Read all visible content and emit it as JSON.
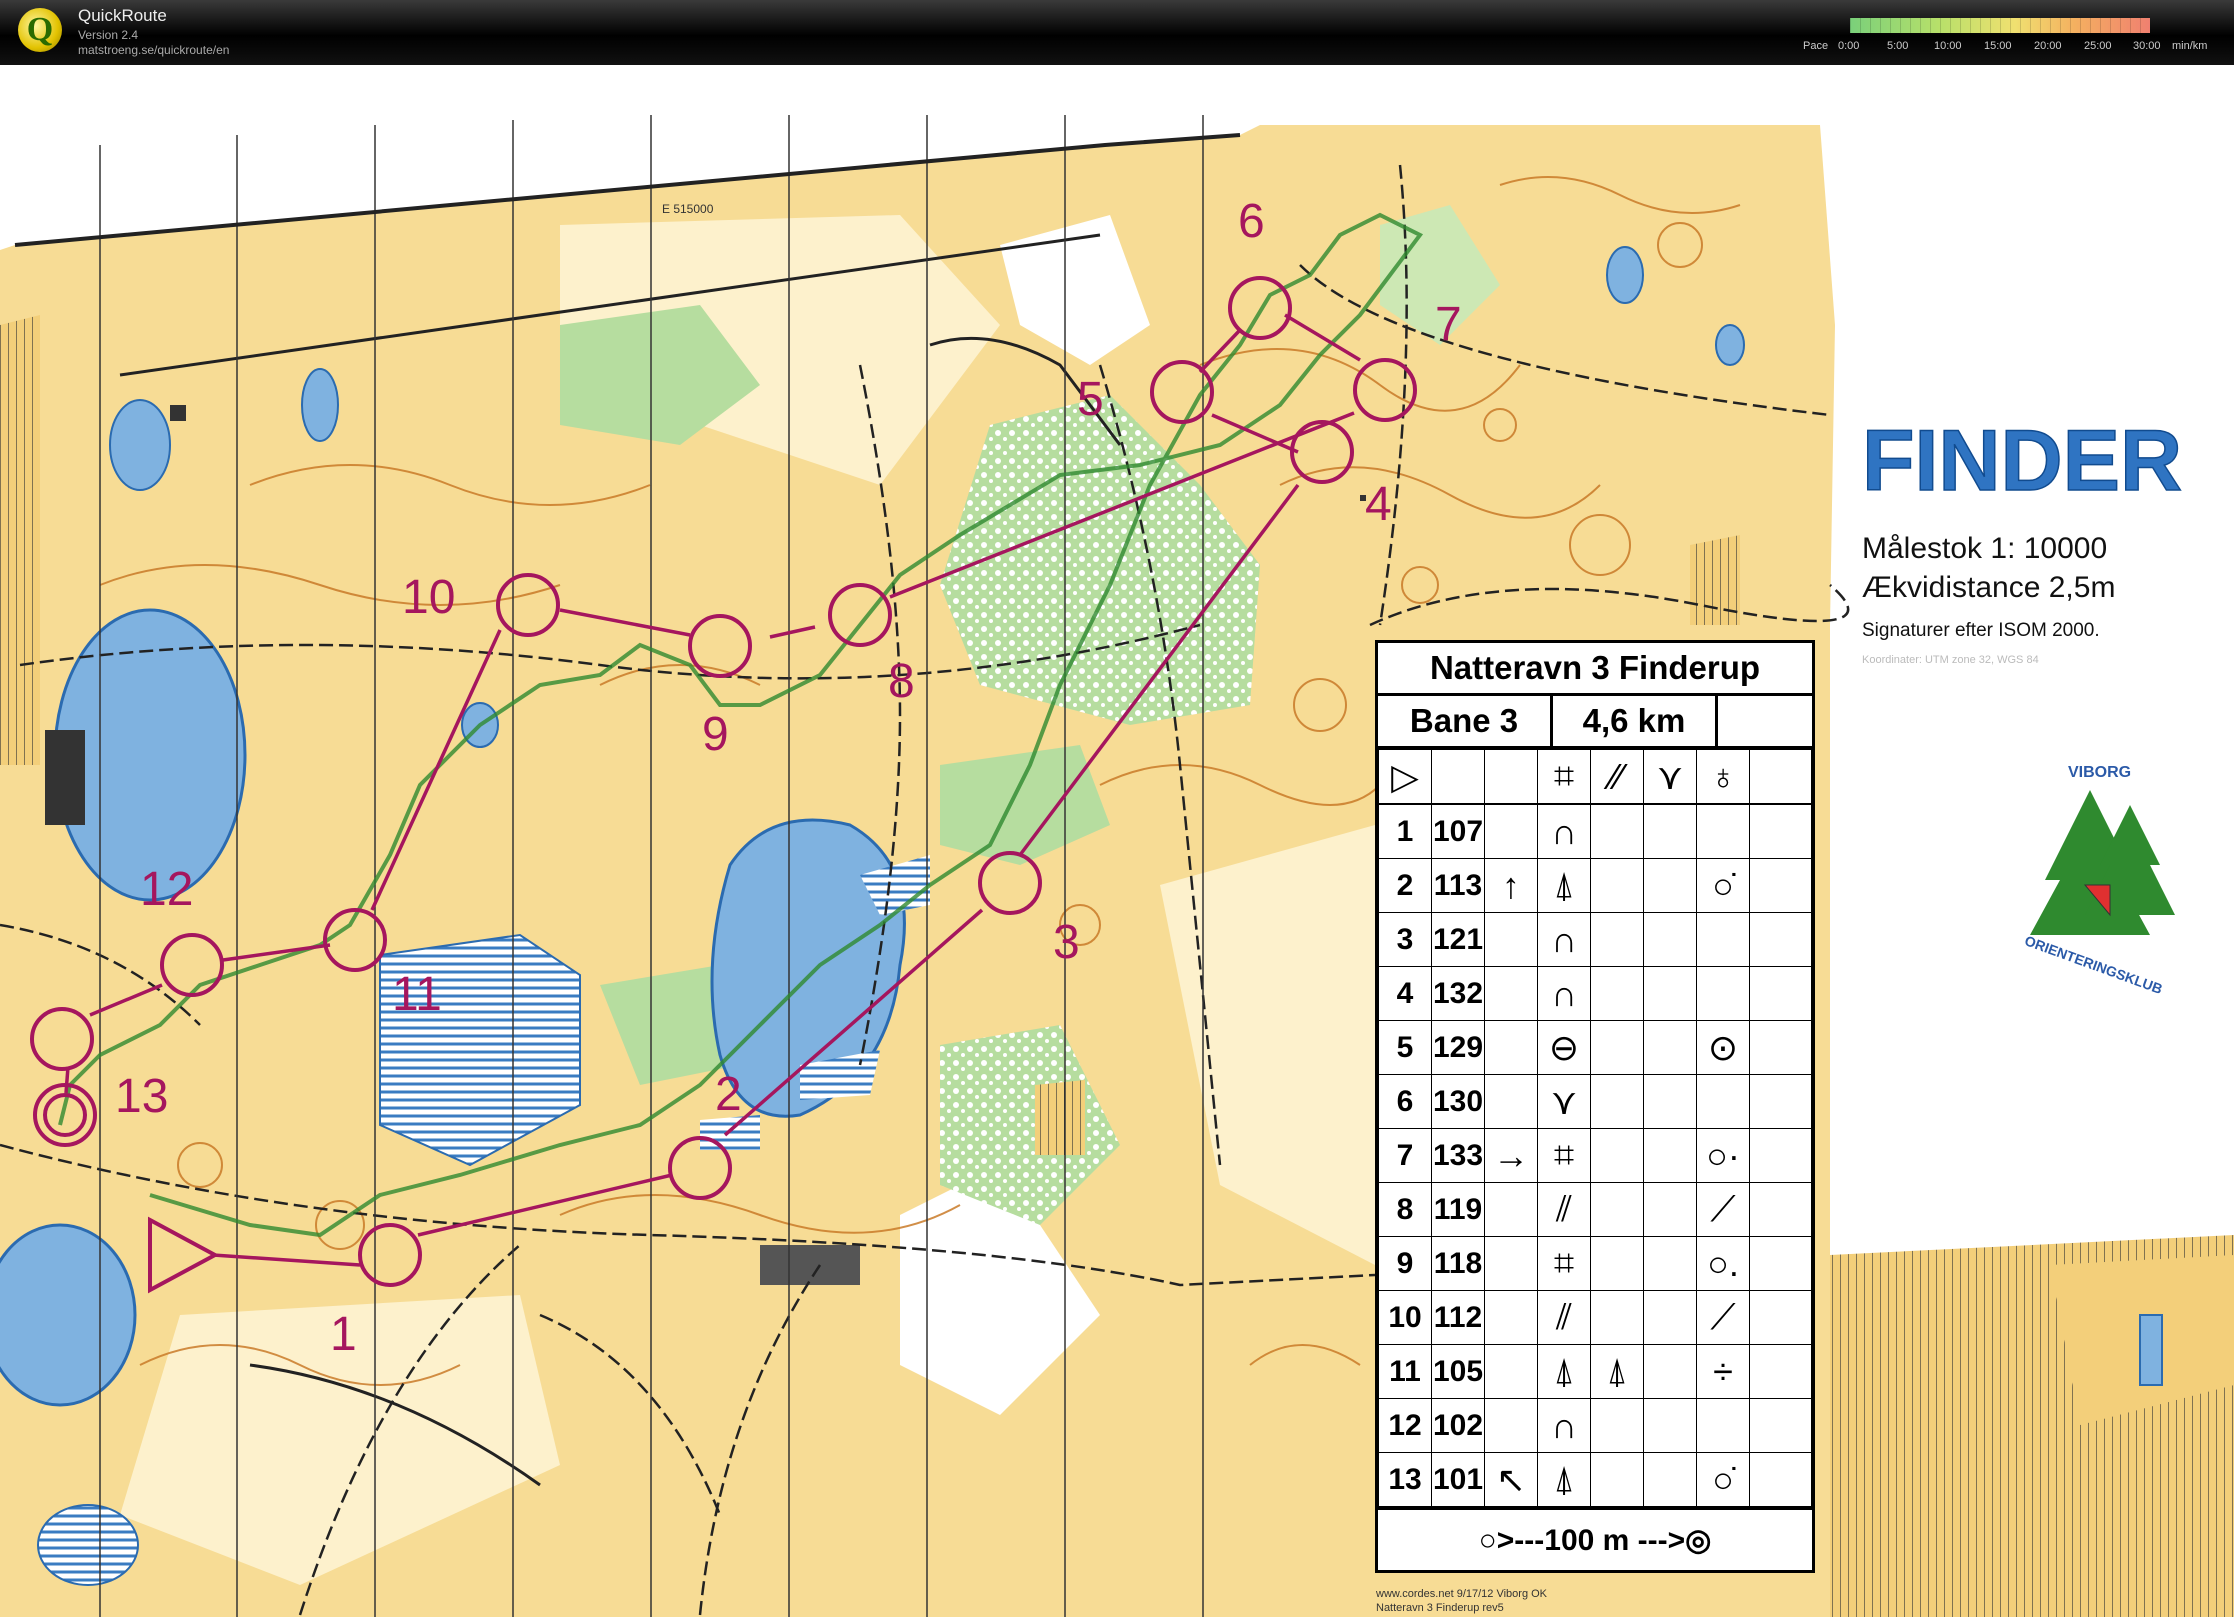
{
  "app": {
    "name": "QuickRoute",
    "version": "Version 2.4",
    "url": "matstroeng.se/quickroute/en"
  },
  "pace_scale": {
    "label": "Pace",
    "ticks": [
      "0:00",
      "5:00",
      "10:00",
      "15:00",
      "20:00",
      "25:00",
      "30:00"
    ],
    "unit": "min/km"
  },
  "map": {
    "grid_label": "E 515000",
    "title": "FINDER",
    "scale": "Målestok 1: 10000",
    "contour": "Ækvidistance 2,5m",
    "symbols": "Signaturer efter ISOM 2000.",
    "coord": "Koordinater: UTM zone 32, WGS 84",
    "club": [
      "VIBORG",
      "ORIENTERINGSKLUB"
    ],
    "imprint": [
      "www.cordes.net 9/17/12 Viborg OK",
      "Natteravn 3 Finderup rev5"
    ],
    "controls": [
      {
        "n": "1"
      },
      {
        "n": "2"
      },
      {
        "n": "3"
      },
      {
        "n": "4"
      },
      {
        "n": "5"
      },
      {
        "n": "6"
      },
      {
        "n": "7"
      },
      {
        "n": "8"
      },
      {
        "n": "9"
      },
      {
        "n": "10"
      },
      {
        "n": "11"
      },
      {
        "n": "12"
      },
      {
        "n": "13"
      }
    ]
  },
  "legend": {
    "title": "Natteravn 3 Finderup",
    "course": "Bane 3",
    "length": "4,6 km",
    "start_row": [
      "▷",
      "",
      "",
      "⌗",
      "⁄⁄",
      "⋎",
      "♁"
    ],
    "rows": [
      {
        "num": "1",
        "code": "107",
        "dir": "",
        "feat": "∩",
        "extra": "",
        "det": ""
      },
      {
        "num": "2",
        "code": "113",
        "dir": "↑",
        "feat": "⍋",
        "extra": "",
        "det": "○̇"
      },
      {
        "num": "3",
        "code": "121",
        "dir": "",
        "feat": "∩",
        "extra": "",
        "det": ""
      },
      {
        "num": "4",
        "code": "132",
        "dir": "",
        "feat": "∩",
        "extra": "",
        "det": ""
      },
      {
        "num": "5",
        "code": "129",
        "dir": "",
        "feat": "⊖",
        "extra": "",
        "det": "⊙"
      },
      {
        "num": "6",
        "code": "130",
        "dir": "",
        "feat": "⋎",
        "extra": "",
        "det": ""
      },
      {
        "num": "7",
        "code": "133",
        "dir": "→",
        "feat": "⌗",
        "extra": "",
        "det": "○·"
      },
      {
        "num": "8",
        "code": "119",
        "dir": "",
        "feat": "⫽",
        "extra": "",
        "det": "⟋"
      },
      {
        "num": "9",
        "code": "118",
        "dir": "",
        "feat": "⌗",
        "extra": "",
        "det": "○."
      },
      {
        "num": "10",
        "code": "112",
        "dir": "",
        "feat": "⫽",
        "extra": "",
        "det": "⟋"
      },
      {
        "num": "11",
        "code": "105",
        "dir": "",
        "feat": "⍋",
        "extra": "⍋",
        "det": "÷"
      },
      {
        "num": "12",
        "code": "102",
        "dir": "",
        "feat": "∩",
        "extra": "",
        "det": ""
      },
      {
        "num": "13",
        "code": "101",
        "dir": "↖",
        "feat": "⍋",
        "extra": "",
        "det": "○̇"
      }
    ],
    "finish": "○>---100 m --->◎"
  },
  "colors": {
    "open": "#f3cf7a",
    "rough": "#fbe6b0",
    "forest": "#ffffff",
    "green": "#9fcf8a",
    "water": "#7fb2e0",
    "course": "#a5165e",
    "contour": "#c97a28"
  }
}
